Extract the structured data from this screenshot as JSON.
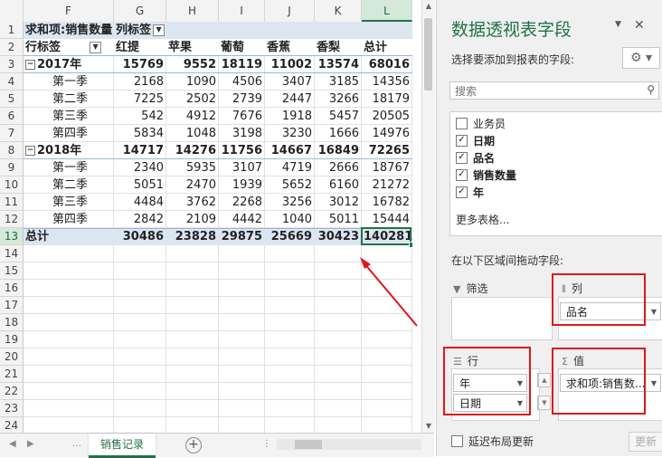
{
  "sheet": {
    "columns": [
      "F",
      "G",
      "H",
      "I",
      "J",
      "K",
      "L"
    ],
    "selected_column": "L",
    "row_numbers": [
      "1",
      "2",
      "3",
      "4",
      "5",
      "6",
      "7",
      "8",
      "9",
      "10",
      "11",
      "12",
      "13",
      "14",
      "15",
      "16",
      "17",
      "18",
      "19",
      "20",
      "21",
      "22",
      "23",
      "24"
    ],
    "selected_row": "13",
    "header_row1": {
      "value_label": "求和项:销售数量",
      "col_label": "列标签"
    },
    "header_row2": {
      "row_label": "行标签",
      "cols": [
        "红提",
        "苹果",
        "葡萄",
        "香蕉",
        "香梨",
        "总计"
      ]
    },
    "rows": [
      {
        "label": "2017年",
        "values": [
          "15769",
          "9552",
          "18119",
          "11002",
          "13574",
          "68016"
        ],
        "type": "group"
      },
      {
        "label": "第一季",
        "values": [
          "2168",
          "1090",
          "4506",
          "3407",
          "3185",
          "14356"
        ],
        "type": "item"
      },
      {
        "label": "第二季",
        "values": [
          "7225",
          "2502",
          "2739",
          "2447",
          "3266",
          "18179"
        ],
        "type": "item"
      },
      {
        "label": "第三季",
        "values": [
          "542",
          "4912",
          "7676",
          "1918",
          "5457",
          "20505"
        ],
        "type": "item"
      },
      {
        "label": "第四季",
        "values": [
          "5834",
          "1048",
          "3198",
          "3230",
          "1666",
          "14976"
        ],
        "type": "item"
      },
      {
        "label": "2018年",
        "values": [
          "14717",
          "14276",
          "11756",
          "14667",
          "16849",
          "72265"
        ],
        "type": "group"
      },
      {
        "label": "第一季",
        "values": [
          "2340",
          "5935",
          "3107",
          "4719",
          "2666",
          "18767"
        ],
        "type": "item"
      },
      {
        "label": "第二季",
        "values": [
          "5051",
          "2470",
          "1939",
          "5652",
          "6160",
          "21272"
        ],
        "type": "item"
      },
      {
        "label": "第三季",
        "values": [
          "4484",
          "3762",
          "2268",
          "3256",
          "3012",
          "16782"
        ],
        "type": "item"
      },
      {
        "label": "第四季",
        "values": [
          "2842",
          "2109",
          "4442",
          "1040",
          "5011",
          "15444"
        ],
        "type": "item"
      },
      {
        "label": "总计",
        "values": [
          "30486",
          "23828",
          "29875",
          "25669",
          "30423",
          "140281"
        ],
        "type": "total"
      }
    ],
    "tab_name": "销售记录",
    "colors": {
      "accent": "#217346",
      "band": "#dce6f1",
      "annotation": "#e0161b"
    }
  },
  "pane": {
    "title": "数据透视表字段",
    "choose_label": "选择要添加到报表的字段:",
    "search_placeholder": "搜索",
    "fields": [
      {
        "label": "业务员",
        "checked": false
      },
      {
        "label": "日期",
        "checked": true
      },
      {
        "label": "品名",
        "checked": true
      },
      {
        "label": "销售数量",
        "checked": true
      },
      {
        "label": "年",
        "checked": true
      }
    ],
    "more_tables": "更多表格...",
    "drag_label": "在以下区域间拖动字段:",
    "zones": {
      "filter": {
        "title": "筛选",
        "items": []
      },
      "columns": {
        "title": "列",
        "items": [
          "品名"
        ]
      },
      "rows": {
        "title": "行",
        "items": [
          "年",
          "日期"
        ]
      },
      "values": {
        "title": "值",
        "items": [
          "求和项:销售数..."
        ]
      }
    },
    "defer_label": "延迟布局更新",
    "update_label": "更新"
  }
}
